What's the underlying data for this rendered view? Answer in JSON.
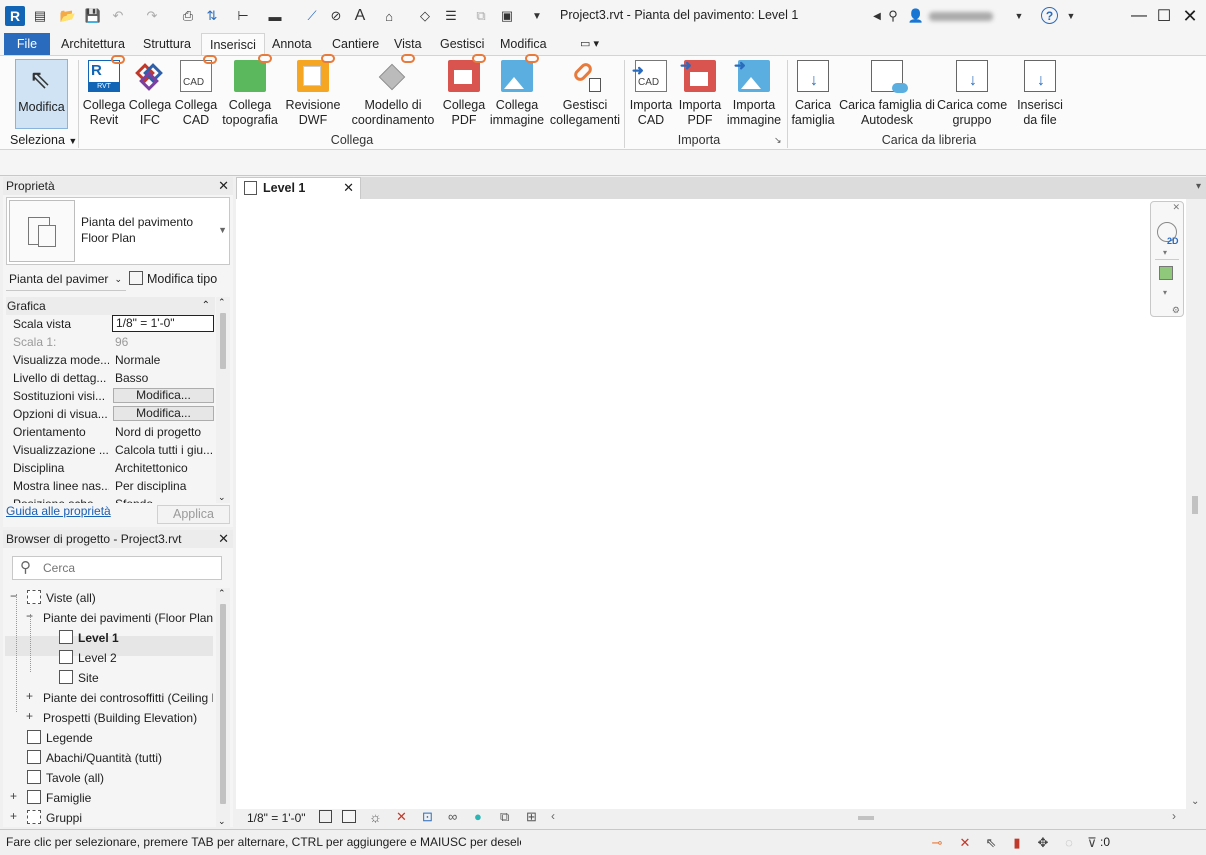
{
  "titlebar": {
    "app_letter": "R",
    "title": "Project3.rvt - Pianta del pavimento: Level 1",
    "help": "?"
  },
  "menu": {
    "file": "File",
    "tabs": [
      "Architettura",
      "Struttura",
      "Inserisci",
      "Annota",
      "Cantiere",
      "Vista",
      "Gestisci",
      "Modifica"
    ]
  },
  "ribbon": {
    "modify": "Modifica",
    "select": "Seleziona",
    "buttons_link": [
      {
        "label": "Collega\nRevit",
        "icon": "link-revit-icon"
      },
      {
        "label": "Collega\nIFC",
        "icon": "link-ifc-icon"
      },
      {
        "label": "Collega\nCAD",
        "icon": "link-cad-icon"
      },
      {
        "label": "Collega\ntopografia",
        "icon": "link-topography-icon"
      },
      {
        "label": "Revisione\nDWF",
        "icon": "dwf-markup-icon"
      },
      {
        "label": "Modello di\ncoordinamento",
        "icon": "coordination-model-icon"
      },
      {
        "label": "Collega\nPDF",
        "icon": "link-pdf-icon"
      },
      {
        "label": "Collega\nimmagine",
        "icon": "link-image-icon"
      },
      {
        "label": "Gestisci\ncollegamenti",
        "icon": "manage-links-icon"
      }
    ],
    "group_link": "Collega",
    "buttons_import": [
      {
        "label": "Importa\nCAD",
        "icon": "import-cad-icon"
      },
      {
        "label": "Importa\nPDF",
        "icon": "import-pdf-icon"
      },
      {
        "label": "Importa\nimmagine",
        "icon": "import-image-icon"
      }
    ],
    "group_import": "Importa",
    "buttons_library": [
      {
        "label": "Carica\nfamiglia",
        "icon": "load-family-icon"
      },
      {
        "label": "Carica famiglia di\nAutodesk",
        "icon": "load-autodesk-family-icon"
      },
      {
        "label": "Carica come\ngruppo",
        "icon": "load-as-group-icon"
      },
      {
        "label": "Inserisci\nda file",
        "icon": "insert-from-file-icon"
      }
    ],
    "group_library": "Carica da libreria",
    "badges": {
      "rvt": "RVT",
      "cad": "CAD",
      "import_cad": "CAD"
    }
  },
  "properties": {
    "title": "Proprietà",
    "type_name_1": "Pianta del pavimento",
    "type_name_2": "Floor Plan",
    "instance_selector": "Pianta del pavimer",
    "edit_type": "Modifica tipo",
    "section": "Grafica",
    "rows": [
      {
        "key": "Scala vista",
        "value": "1/8\" = 1'-0\""
      },
      {
        "key": "Scala  1:",
        "value": "96"
      },
      {
        "key": "Visualizza mode...",
        "value": "Normale"
      },
      {
        "key": "Livello di dettag...",
        "value": "Basso"
      },
      {
        "key": "Sostituzioni visi...",
        "value": "Modifica..."
      },
      {
        "key": "Opzioni di visua...",
        "value": "Modifica..."
      },
      {
        "key": "Orientamento",
        "value": "Nord di progetto"
      },
      {
        "key": "Visualizzazione ...",
        "value": "Calcola tutti i giu..."
      },
      {
        "key": "Disciplina",
        "value": "Architettonico"
      },
      {
        "key": "Mostra linee nas...",
        "value": "Per disciplina"
      },
      {
        "key": "Posizione sche...",
        "value": "Sfondo"
      }
    ],
    "help_link": "Guida alle proprietà",
    "apply": "Applica"
  },
  "browser": {
    "title": "Browser di progetto - Project3.rvt",
    "search_placeholder": "Cerca",
    "items": [
      {
        "label": "Viste (all)"
      },
      {
        "label": "Piante dei pavimenti (Floor Plan)"
      },
      {
        "label": "Level 1"
      },
      {
        "label": "Level 2"
      },
      {
        "label": "Site"
      },
      {
        "label": "Piante dei controsoffitti (Ceiling Plan)"
      },
      {
        "label": "Prospetti (Building Elevation)"
      },
      {
        "label": "Legende"
      },
      {
        "label": "Abachi/Quantità (tutti)"
      },
      {
        "label": "Tavole (all)"
      },
      {
        "label": "Famiglie"
      },
      {
        "label": "Gruppi"
      }
    ]
  },
  "view": {
    "tab_label": "Level 1",
    "scale": "1/8\" = 1'-0\"",
    "nav_2d": "2D"
  },
  "status": {
    "message": "Fare clic per selezionare, premere TAB per alternare, CTRL per aggiungere e MAIUSC per deselezionare.",
    "filter_count": ":0"
  }
}
